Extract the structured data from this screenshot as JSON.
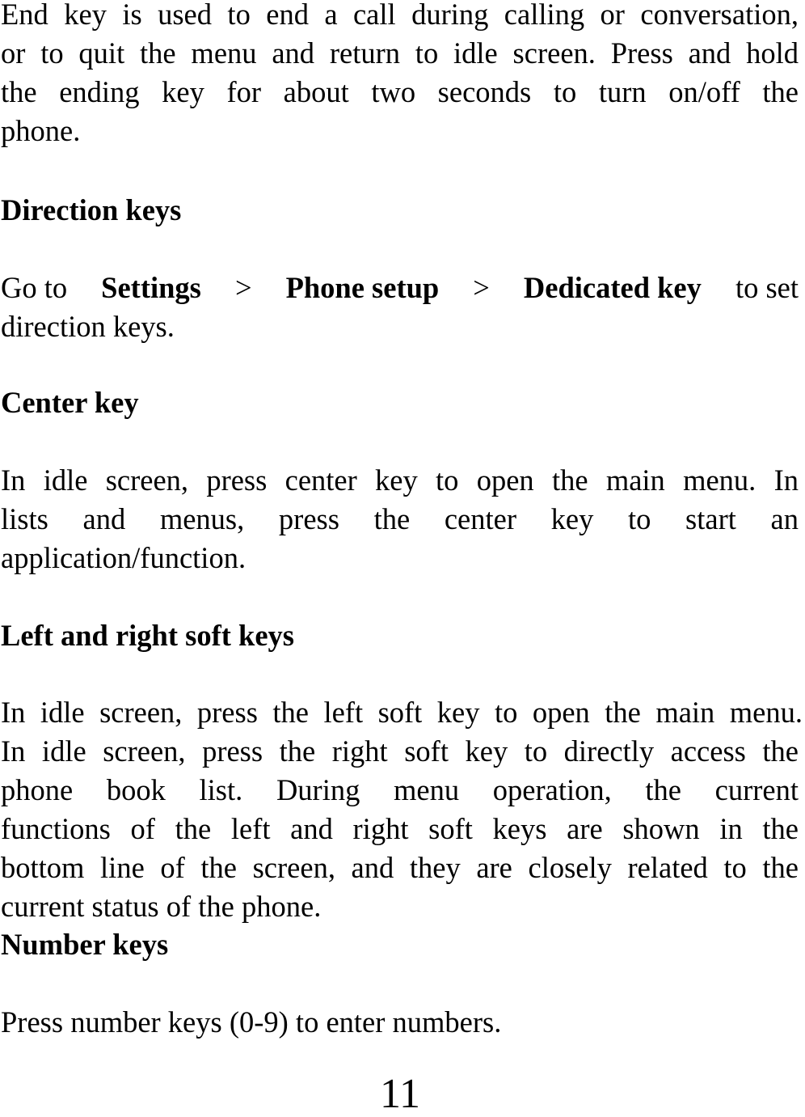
{
  "page": {
    "page_number": "11"
  },
  "sections": {
    "end_key": {
      "line1": "End key is used to end a call during calling or conversation,",
      "line2": "or to quit the menu and return to idle screen. Press and hold",
      "line3": "the ending key for about two seconds to turn on/off the",
      "line4": "phone."
    },
    "direction_keys": {
      "heading": "Direction keys",
      "go_to": "Go to",
      "menu_settings": "Settings",
      "separator": ">",
      "menu_phone_setup": "Phone setup",
      "menu_dedicated_key": "Dedicated key",
      "to_set": "to set",
      "line2": "direction keys."
    },
    "center_key": {
      "heading": "Center key",
      "line1": "In idle screen, press center key to open the main menu. In",
      "line2": "lists and menus, press the center key to start an",
      "line3": "application/function."
    },
    "soft_keys": {
      "heading": "Left and right soft keys",
      "line1": "In idle screen, press the left soft key to open the main menu.",
      "line2": "In idle screen, press the right soft key to directly access the",
      "line3": "phone book list. During menu operation, the current",
      "line4": "functions of the left and right soft keys are shown in the",
      "line5": "bottom line of the screen, and they are closely related to the",
      "line6": "current status of the phone."
    },
    "number_keys": {
      "heading": "Number keys",
      "line1": "Press number keys (0-9) to enter numbers."
    }
  }
}
